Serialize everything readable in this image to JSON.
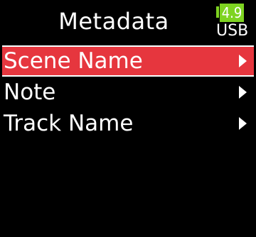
{
  "header": {
    "title": "Metadata",
    "battery": {
      "level_text": "4.9",
      "source_label": "USB",
      "color": "#7ed321"
    }
  },
  "menu": {
    "items": [
      {
        "label": "Scene Name",
        "selected": true,
        "icon": "chevron-right-icon"
      },
      {
        "label": "Note",
        "selected": false,
        "icon": "chevron-right-icon"
      },
      {
        "label": "Track Name",
        "selected": false,
        "icon": "chevron-right-icon"
      }
    ],
    "selected_color": "#e6363e"
  }
}
